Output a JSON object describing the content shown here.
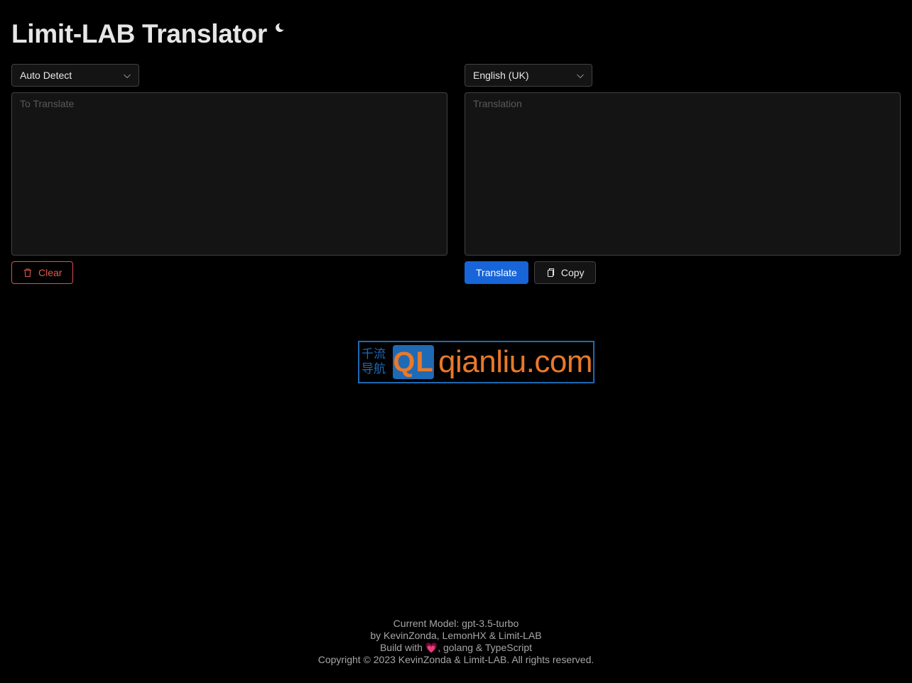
{
  "header": {
    "title": "Limit-LAB Translator",
    "theme_icon": "moon-icon"
  },
  "source": {
    "language": "Auto Detect",
    "placeholder": "To Translate",
    "value": "",
    "clear_label": "Clear",
    "clear_icon": "trash-icon"
  },
  "target": {
    "language": "English (UK)",
    "placeholder": "Translation",
    "value": "",
    "translate_label": "Translate",
    "copy_label": "Copy",
    "copy_icon": "copy-icon"
  },
  "logo": {
    "cn_line1": "千流",
    "cn_line2": "导航",
    "mark": "QL",
    "domain": "qianliu.com"
  },
  "footer": {
    "model_line": "Current Model: gpt-3.5-turbo",
    "authors_line": "by KevinZonda, LemonHX & Limit-LAB",
    "build_prefix": "Build with ",
    "build_heart": "💗",
    "build_suffix": ", golang & TypeScript",
    "copyright_line": "Copyright © 2023 KevinZonda & Limit-LAB. All rights reserved."
  },
  "colors": {
    "background": "#000000",
    "primary": "#1765d8",
    "danger": "#e0584f",
    "logo_blue": "#1f6ab5",
    "logo_orange": "#e8792a"
  }
}
